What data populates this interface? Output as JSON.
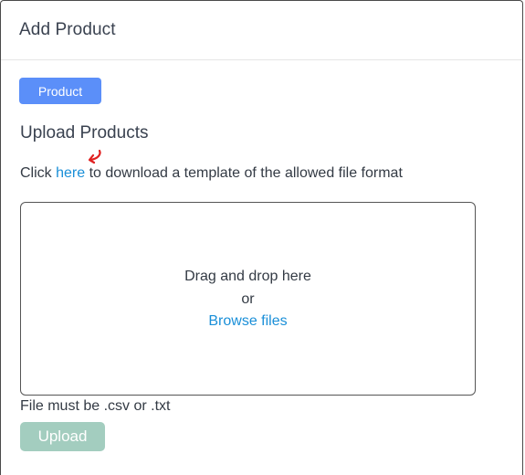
{
  "dialog": {
    "title": "Add Product"
  },
  "tag_button": {
    "label": "Product",
    "color": "#5b8ff9"
  },
  "upload_section": {
    "title": "Upload Products",
    "instruction_prefix": "Click ",
    "instruction_link": "here",
    "instruction_suffix": " to download a template of the allowed file format"
  },
  "dropzone": {
    "line1": "Drag and drop here",
    "line2": "or",
    "browse_label": "Browse files"
  },
  "file_note": "File must be .csv or .txt",
  "upload_button": {
    "label": "Upload",
    "color": "#a3cdbf",
    "disabled": true
  },
  "annotation": {
    "icon": "red-curved-arrow-icon",
    "color": "#e02020"
  }
}
